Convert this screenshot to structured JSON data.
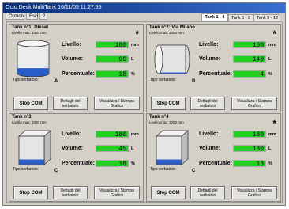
{
  "window": {
    "title": "Octo Desk MultiTank 16/11/05  11.27.55"
  },
  "menu": [
    "Opzioni",
    "Esci",
    "?"
  ],
  "tabs": [
    {
      "label": "Tank 1 - 4",
      "active": true
    },
    {
      "label": "Tank 5 - 8",
      "active": false
    },
    {
      "label": "Tank 9 - 12",
      "active": false
    }
  ],
  "labels": {
    "livello": "Livello:",
    "volume": "Volume:",
    "percentuale": "Percentuale:",
    "tipo": "Tipo serbatoio:",
    "stop": "Stop COM",
    "dettagli": "Dettagli del serbatoio",
    "visualizza": "Visualizza / Stampa Grafico",
    "unit_mm": "mm",
    "unit_l": "L",
    "unit_pct": "%"
  },
  "tanks": [
    {
      "title": "Tank n°1: Diesel",
      "level_max": "Livello max: 1000 mm",
      "livello": "180",
      "volume": "90",
      "percentuale": "18",
      "type": "A",
      "shape": "vertical-cylinder",
      "fill": 0.18,
      "star": "*"
    },
    {
      "title": "Tank n°2: Via Milano",
      "level_max": "Livello max: 2000 mm",
      "livello": "180",
      "volume": "140",
      "percentuale": "4",
      "type": "B",
      "shape": "horizontal-cylinder",
      "fill": 0.04,
      "star": "*"
    },
    {
      "title": "Tank n°3",
      "level_max": "Livello max: 1000 mm",
      "livello": "180",
      "volume": "45",
      "percentuale": "18",
      "type": "C",
      "shape": "box",
      "fill": 0.18,
      "star": ""
    },
    {
      "title": "Tank n°4",
      "level_max": "Livello max: 1000 mm",
      "livello": "180",
      "volume": "180",
      "percentuale": "18",
      "type": "C",
      "shape": "box",
      "fill": 0.18,
      "star": "*"
    }
  ],
  "colors": {
    "display_green": "#22d022",
    "liquid_blue": "#2a5cc8",
    "title_blue": "#0a2f7a"
  }
}
